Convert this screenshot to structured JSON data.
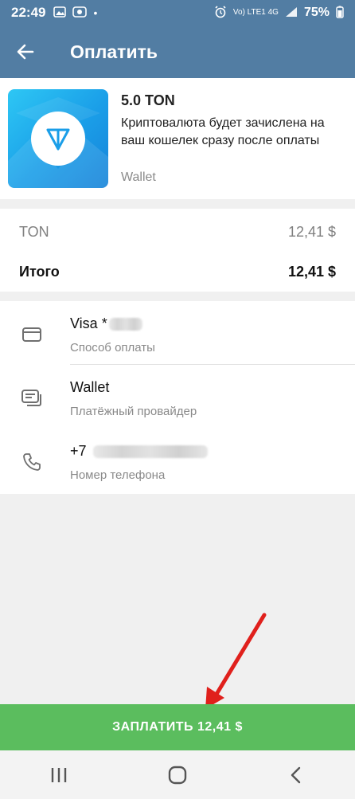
{
  "status_bar": {
    "time": "22:49",
    "network": "Vo) LTE1 4G",
    "battery": "75%"
  },
  "app_bar": {
    "title": "Оплатить"
  },
  "product": {
    "title": "5.0 TON",
    "description": "Криптовалюта будет зачислена на ваш кошелек сразу после оплаты",
    "seller": "Wallet"
  },
  "prices": {
    "item_label": "TON",
    "item_value": "12,41 $",
    "total_label": "Итого",
    "total_value": "12,41 $"
  },
  "details": {
    "card": {
      "value": "Visa *",
      "label": "Способ оплаты"
    },
    "provider": {
      "value": "Wallet",
      "label": "Платёжный провайдер"
    },
    "phone": {
      "value": "+7",
      "label": "Номер телефона"
    }
  },
  "pay_button": {
    "label": "ЗАПЛАТИТЬ 12,41 $"
  },
  "colors": {
    "header": "#527da3",
    "pay_button": "#5bbd5e",
    "annotation_arrow": "#e0201c"
  },
  "icons": [
    "back-arrow-icon",
    "card-icon",
    "provider-icon",
    "phone-icon",
    "ton-logo-icon",
    "nav-recents-icon",
    "nav-home-icon",
    "nav-back-icon"
  ]
}
